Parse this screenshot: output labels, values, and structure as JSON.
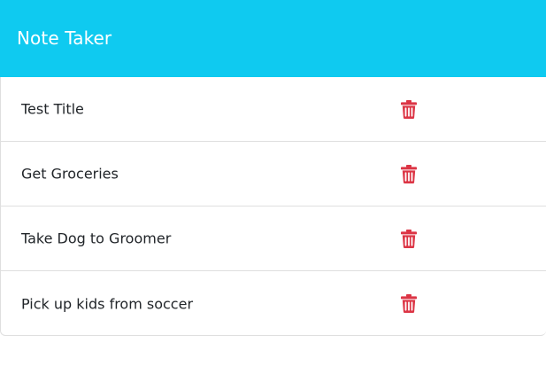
{
  "app": {
    "title": "Note Taker"
  },
  "notes": [
    {
      "title": "Test Title",
      "delete_icon": "trash-icon"
    },
    {
      "title": "Get Groceries",
      "delete_icon": "trash-icon"
    },
    {
      "title": "Take Dog to Groomer",
      "delete_icon": "trash-icon"
    },
    {
      "title": "Pick up kids from soccer",
      "delete_icon": "trash-icon"
    }
  ],
  "colors": {
    "navbar_bg": "#0fcaf0",
    "navbar_text": "#ffffff",
    "delete_icon": "#dc3545",
    "text": "#212529",
    "divider": "#dfdfdf"
  }
}
